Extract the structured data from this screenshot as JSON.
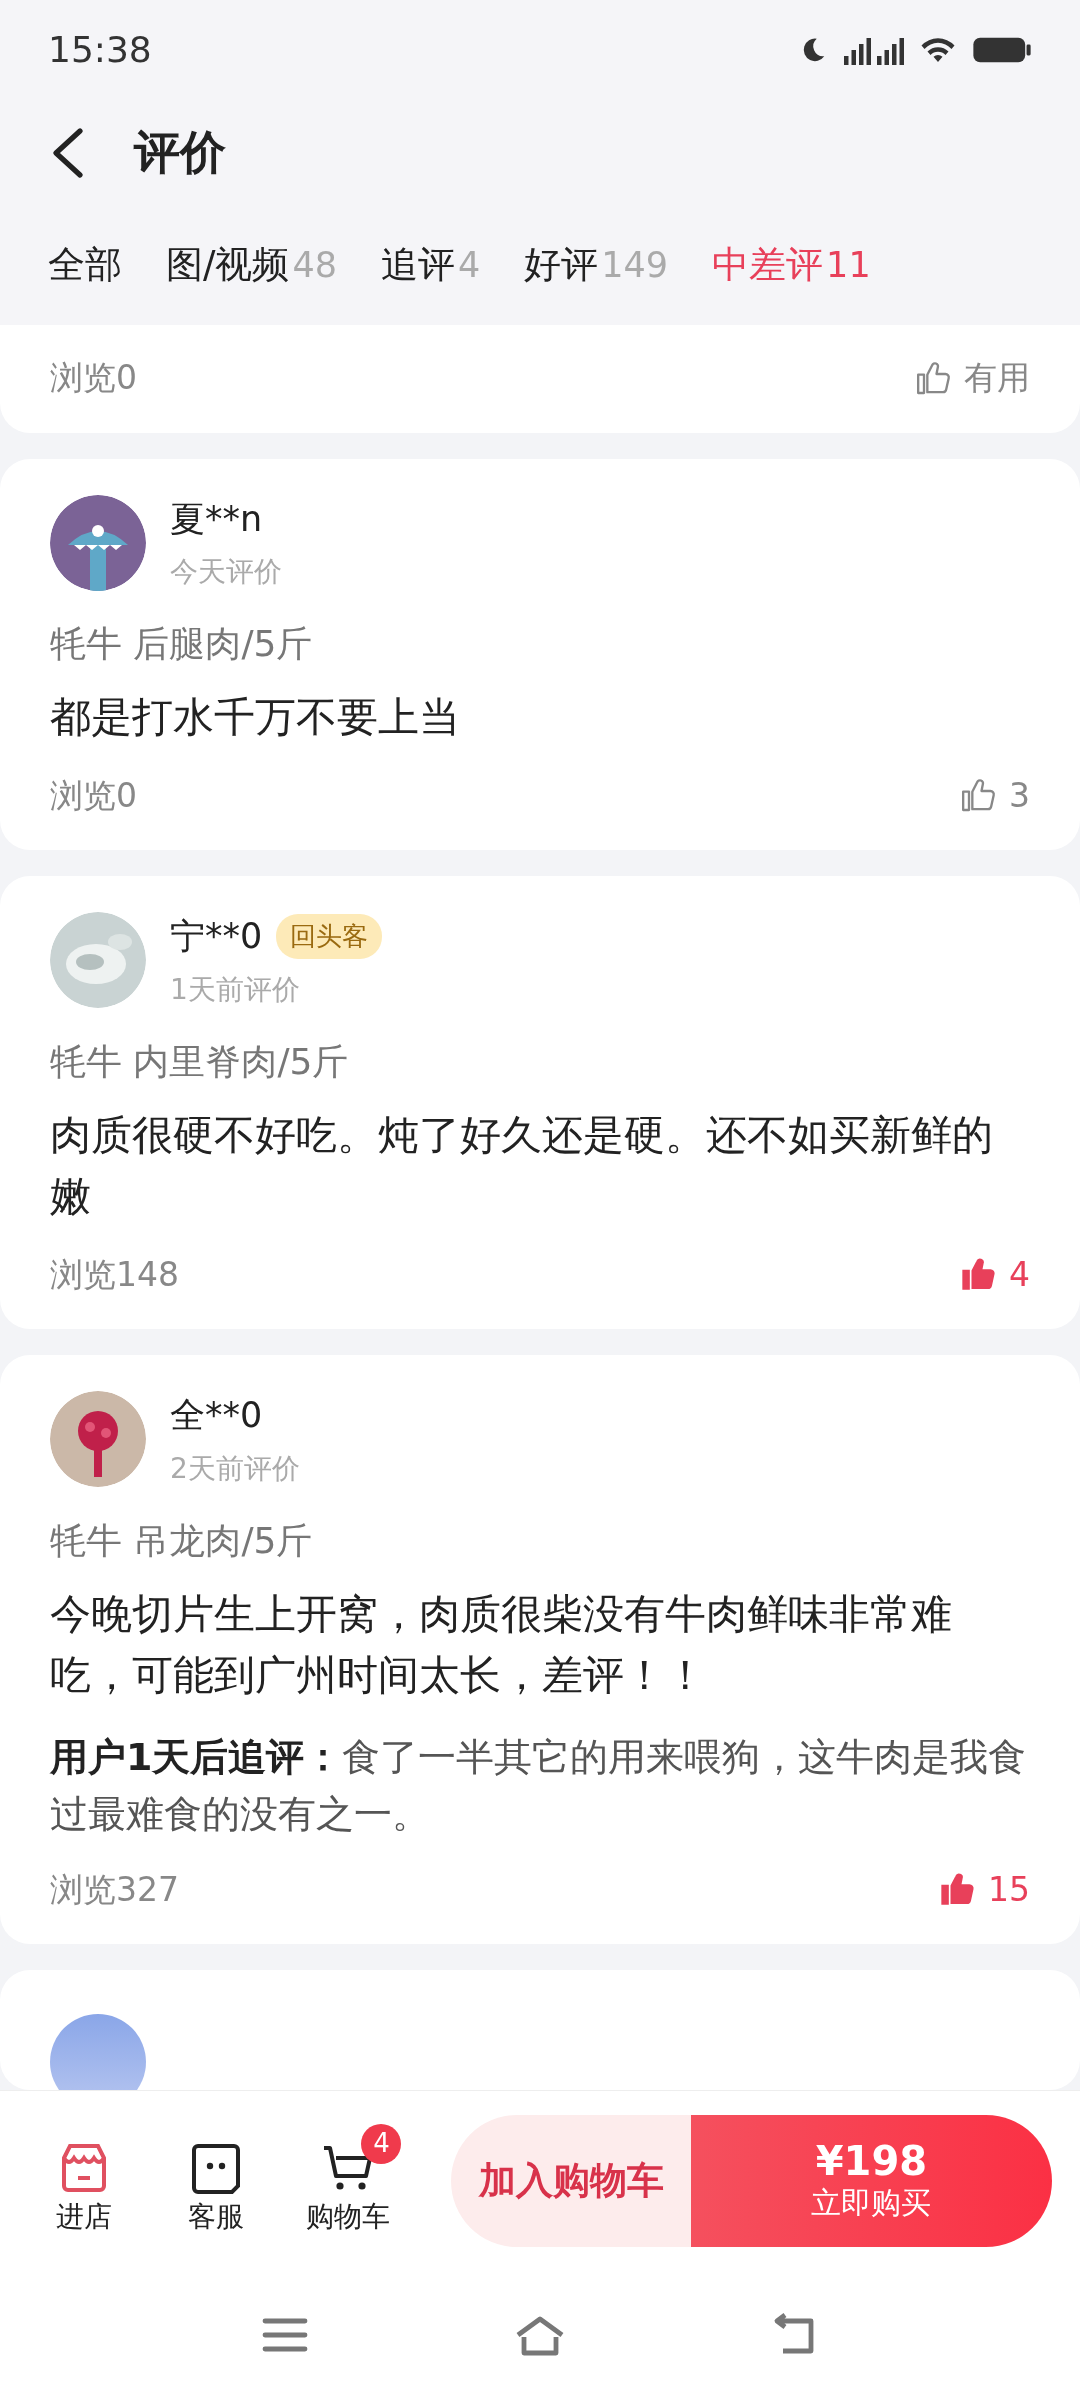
{
  "status_bar": {
    "time": "15:38"
  },
  "header": {
    "title": "评价"
  },
  "tabs": [
    {
      "label": "全部",
      "selected": false
    },
    {
      "label": "图/视频",
      "count": "48",
      "selected": false
    },
    {
      "label": "追评",
      "count": "4",
      "selected": false
    },
    {
      "label": "好评",
      "count": "149",
      "selected": false
    },
    {
      "label": "中差评",
      "count": "11",
      "selected": true
    }
  ],
  "reviews": [
    {
      "kind": "tail",
      "views": "浏览0",
      "helpful": "有用",
      "liked": false
    },
    {
      "kind": "full",
      "user": "夏**n",
      "time": "今天评价",
      "spec": "牦牛 后腿肉/5斤",
      "text": "都是打水千万不要上当",
      "views": "浏览0",
      "likes": "3",
      "liked": false
    },
    {
      "kind": "full",
      "user": "宁**0",
      "badge": "回头客",
      "time": "1天前评价",
      "spec": "牦牛 内里脊肉/5斤",
      "text": "肉质很硬不好吃。炖了好久还是硬。还不如买新鲜的嫩",
      "views": "浏览148",
      "likes": "4",
      "liked": true
    },
    {
      "kind": "full",
      "user": "全**0",
      "time": "2天前评价",
      "spec": "牦牛 吊龙肉/5斤",
      "text": "今晚切片生上开窝，肉质很柴没有牛肉鲜味非常难吃，可能到广州时间太长，差评！！",
      "followup": "**用户1天后追评：**食了一半其它的用来喂狗，这牛肉是我食过最难食的没有之一。",
      "views": "浏览327",
      "likes": "15",
      "liked": true
    },
    {
      "kind": "cut"
    }
  ],
  "bottom_bar": {
    "icons": [
      {
        "kind": "shop",
        "label": "进店"
      },
      {
        "kind": "service",
        "label": "客服"
      },
      {
        "kind": "cart",
        "label": "购物车",
        "badge": "4"
      }
    ],
    "add_to_cart": "加入购物车",
    "price": "¥198",
    "buy_now": "立即购买"
  }
}
